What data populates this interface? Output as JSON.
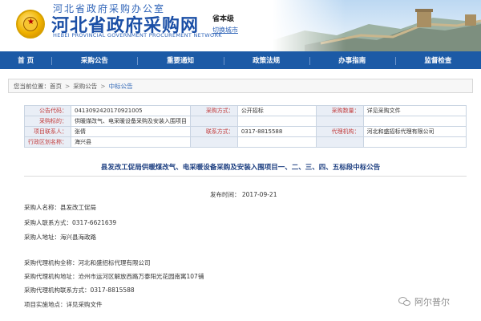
{
  "header": {
    "top_text": "河北省政府采购办公室",
    "title": "河北省政府采购网",
    "subtitle_en": "HEBEI PROVINCIAL GOVERNMENT PROCUREMENT NETWORK",
    "region": "省本级",
    "switch_city": "切换城市"
  },
  "nav": {
    "items": [
      "首 页",
      "采购公告",
      "重要通知",
      "政策法规",
      "办事指南",
      "监督检查"
    ]
  },
  "breadcrumb": {
    "prefix": "您当前位置：",
    "items": [
      "首页",
      "采购公告",
      "中标公告"
    ],
    "sep": ">"
  },
  "info": {
    "rows": [
      [
        {
          "k": "公告代码：",
          "v": "0413092420170921005"
        },
        {
          "k": "采购方式：",
          "v": "公开招标"
        },
        {
          "k": "采购数量：",
          "v": "详见采购文件"
        }
      ],
      [
        {
          "k": "采购标的：",
          "v": "供暖煤改气、电采暖设备采购及安装入围项目"
        },
        {
          "k": "",
          "v": ""
        },
        {
          "k": "",
          "v": ""
        }
      ],
      [
        {
          "k": "项目联系人：",
          "v": "张倩"
        },
        {
          "k": "联系方式：",
          "v": "0317-8815588"
        },
        {
          "k": "代理机构：",
          "v": "河北和盛招标代理有限公司"
        }
      ],
      [
        {
          "k": "行政区划名称：",
          "v": "海兴县"
        },
        {
          "k": "",
          "v": ""
        },
        {
          "k": "",
          "v": ""
        }
      ]
    ]
  },
  "notice": {
    "title": "县发改工促局供暖煤改气、电采暖设备采购及安装入围项目一、二、三、四、五标段中标公告",
    "published": "发布时间：   2017-09-21"
  },
  "details": [
    "采购人名称：县发改工促局",
    "采购人联系方式：0317-6621639",
    "采购人地址：海兴县海政路",
    "采购代理机构全称：河北和盛招标代理有限公司",
    "采购代理机构地址：沧州市运河区解放西路万泰阳光花园南寓107铺",
    "采购代理机构联系方式：0317-8815588",
    "项目实施地点：详见采购文件"
  ],
  "watermark": {
    "text": "阿尔普尔"
  },
  "colors": {
    "nav": "#1c5aa6",
    "title_blue": "#1b4fa6",
    "label_red": "#c23c3c"
  }
}
